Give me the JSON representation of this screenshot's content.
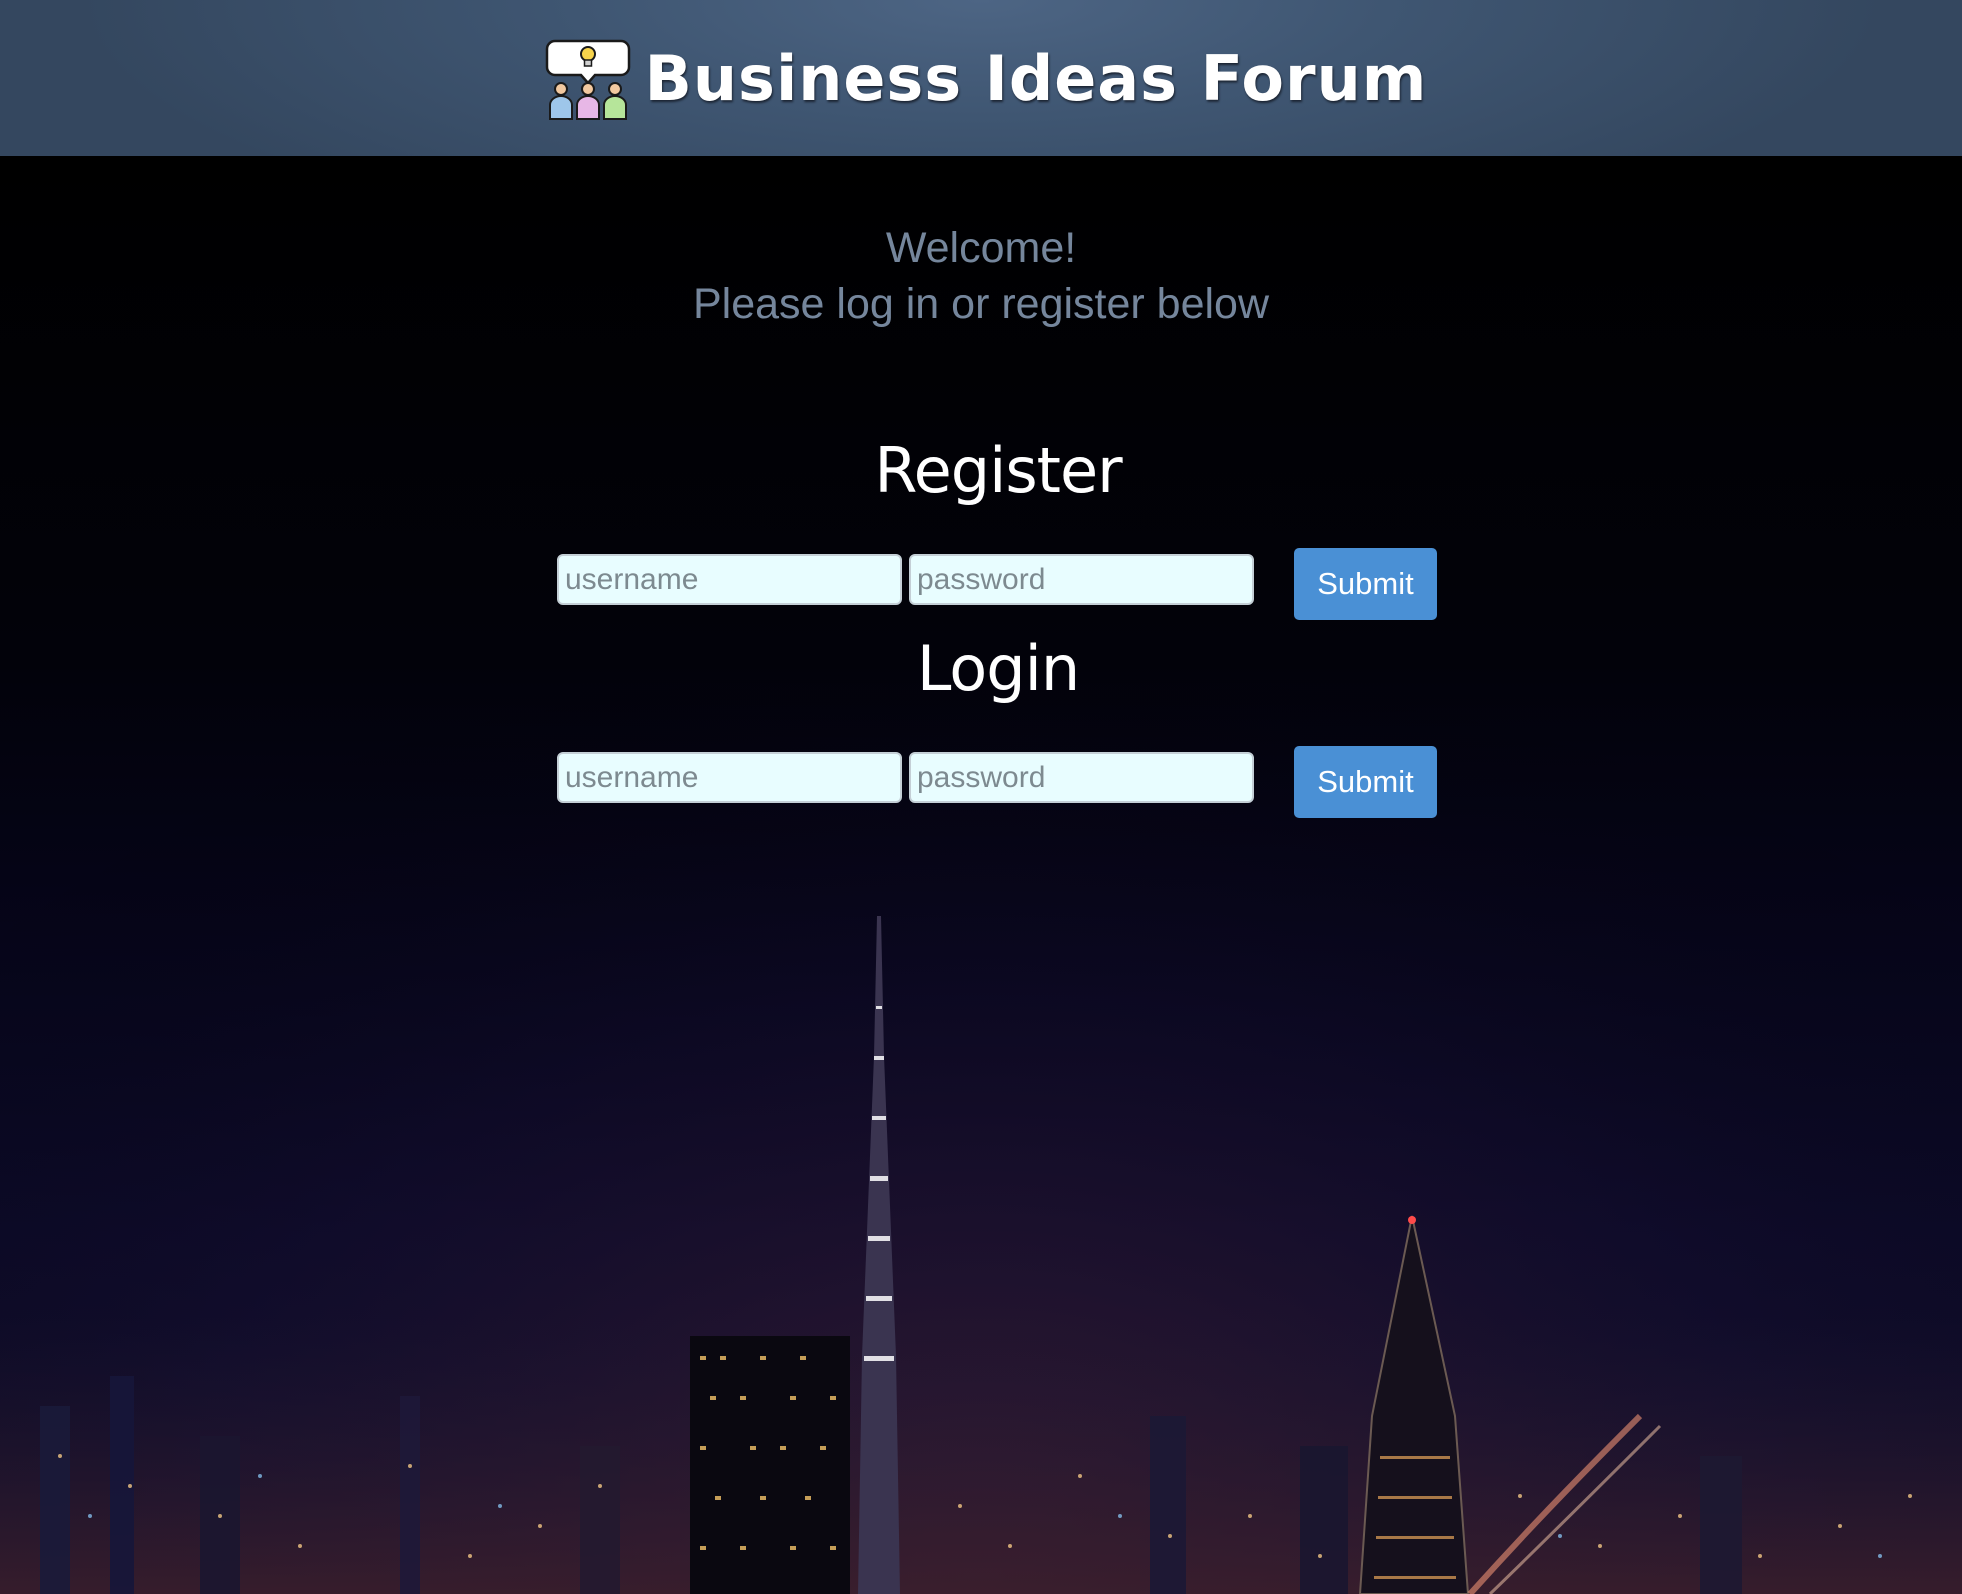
{
  "header": {
    "title": "Business Ideas Forum",
    "logo_icon": "forum-people-lightbulb-icon"
  },
  "welcome": {
    "line1": "Welcome!",
    "line2": "Please log in or register below"
  },
  "register": {
    "heading": "Register",
    "username_placeholder": "username",
    "password_placeholder": "password",
    "submit_label": "Submit"
  },
  "login": {
    "heading": "Login",
    "username_placeholder": "username",
    "password_placeholder": "password",
    "submit_label": "Submit"
  },
  "colors": {
    "header_bg": "#3f5672",
    "button_bg": "#4a90d5",
    "input_bg": "#e8fdff",
    "welcome_text": "#75869c"
  }
}
